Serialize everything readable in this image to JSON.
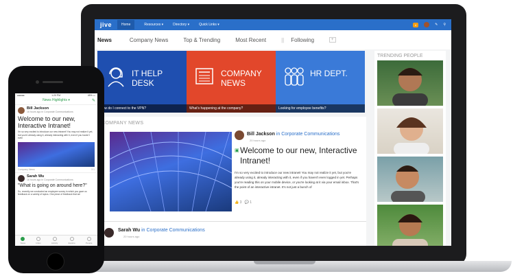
{
  "colors": {
    "brand_blue": "#2a6fc9",
    "help_tile": "#1f4fb0",
    "news_tile": "#e2472b",
    "hr_tile": "#3a7ad8",
    "mobile_accent": "#2a9d4b"
  },
  "topbar": {
    "logo": "jive",
    "nav": [
      "Home",
      "Resources ▾",
      "Directory ▾",
      "Quick Links ▾"
    ],
    "badge": "4"
  },
  "tabs": {
    "items": [
      "News",
      "Company News",
      "Top & Trending",
      "Most Recent",
      "Following"
    ],
    "plus": "+"
  },
  "tiles": [
    {
      "title": "IT HELP DESK",
      "caption": "How do I connect to the VPN?",
      "icon": "headset-person-icon"
    },
    {
      "title": "COMPANY NEWS",
      "caption": "What's happening at the company?",
      "icon": "newspaper-icon"
    },
    {
      "title": "HR DEPT.",
      "caption": "Looking for employee benefits?",
      "icon": "people-group-icon"
    }
  ],
  "feed": {
    "section_label": "COMPANY NEWS",
    "post1": {
      "author": "Bill Jackson",
      "place_prefix": " in ",
      "place": "Corporate Communications",
      "time": "20 hours ago",
      "headline": "Welcome to our new, Interactive Intranet!",
      "body": "I'm so very excited to introduce our new intranet! You may not realize it yet, but you're already using it, already interacting with it, even if you haven't even logged in yet. Perhaps you're reading this on your mobile device, or you're looking at it via your email inbox. That's the point of an interactive intranet. It's not just a bunch of",
      "likes": "3",
      "comments": "1"
    },
    "post2": {
      "author": "Sarah Wu",
      "place_prefix": " in ",
      "place": "Corporate Communications",
      "time": "20 hours ago"
    }
  },
  "trending": {
    "label": "TRENDING PEOPLE"
  },
  "phone": {
    "status_left": "●●●●● ",
    "status_time": "1:20 PM",
    "status_right": "45% ▭",
    "header": "News Highlights ▾",
    "post1": {
      "author": "Bill Jackson",
      "meta": "16 hours ago in Corporate Communications",
      "headline": "Welcome to our new, Interactive Intranet!",
      "body": "I'm so very excited to introduce our new intranet! You may not realize it yet, but you're already using it, already interacting with it, even if you haven't even",
      "place": "Company News",
      "stats": "3  1"
    },
    "post2": {
      "author": "Sarah Wu",
      "meta": "16 hours ago in Corporate Communications",
      "headline": "\"What is going on around here?\"",
      "body": "So, recently we conducted an employee survey in which you gave us feedback on a variety of topics. One piece of feedback that we"
    },
    "tabbar": [
      "News",
      "Inbox",
      "Activity",
      "Explore",
      "People"
    ]
  }
}
